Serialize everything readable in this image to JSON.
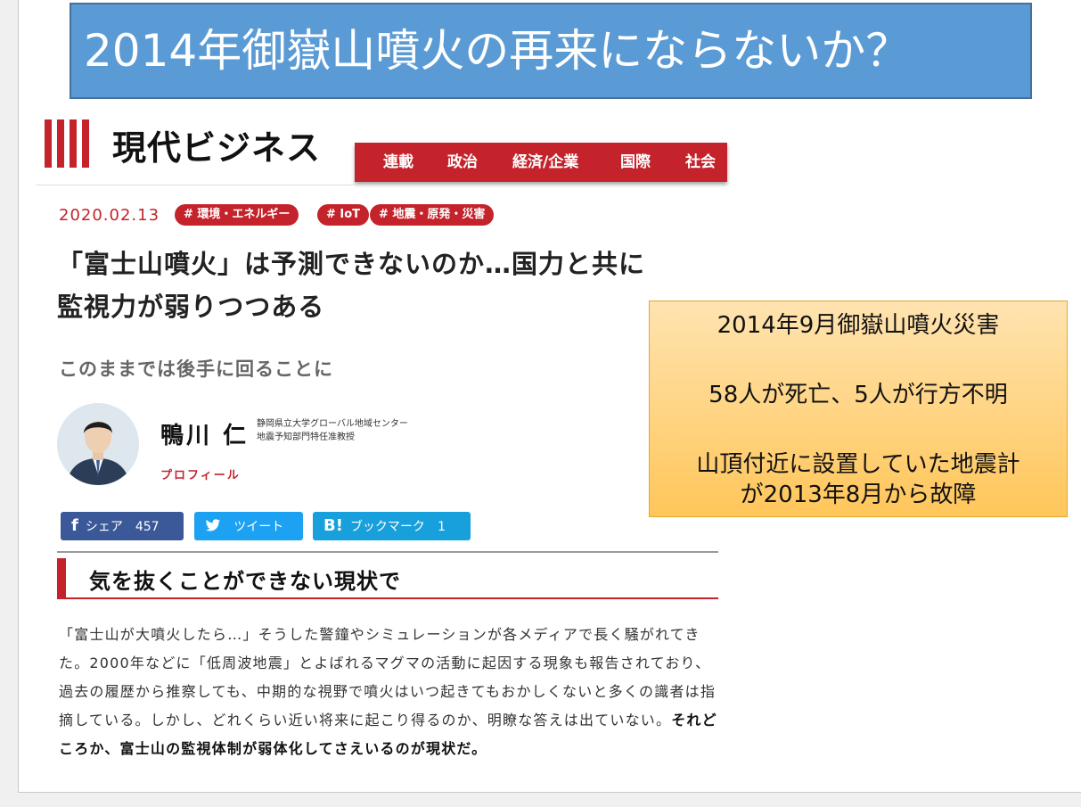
{
  "slide_title": "2014年御嶽山噴火の再来にならないか？",
  "site": {
    "logo_text": "現代ビジネス",
    "nav": [
      "連載",
      "政治",
      "経済/企業",
      "国際",
      "社会"
    ],
    "brand_color": "#c4232b"
  },
  "article": {
    "date": "2020.02.13",
    "tags": [
      "# 環境・エネルギー",
      "# IoT",
      "# 地震・原発・災害"
    ],
    "headline_line1": "「富士山噴火」は予測できないのか…国力と共に",
    "headline_line2": "監視力が弱りつつある",
    "subheadline": "このままでは後手に回ることに",
    "author": {
      "name": "鴨川 仁",
      "affiliation_line1": "静岡県立大学グローバル地域センター",
      "affiliation_line2": "地震予知部門特任准教授",
      "profile_label": "プロフィール"
    },
    "share": {
      "facebook_label": "シェア",
      "facebook_count": "457",
      "twitter_label": "ツイート",
      "hatena_label": "ブックマーク",
      "hatena_count": "1"
    },
    "section_heading": "気を抜くことができない現状で",
    "body_normal": "「富士山が大噴火したら…」そうした警鐘やシミュレーションが各メディアで長く騒がれてきた。2000年などに「低周波地震」とよばれるマグマの活動に起因する現象も報告されており、過去の履歴から推察しても、中期的な視野で噴火はいつ起きてもおかしくないと多くの識者は指摘している。しかし、どれくらい近い将来に起こり得るのか、明瞭な答えは出ていない。",
    "body_bold": "それどころか、富士山の監視体制が弱体化してさえいるのが現状だ。"
  },
  "callout": {
    "line1": "2014年9月御嶽山噴火災害",
    "line2": "58人が死亡、5人が行方不明",
    "line3": "山頂付近に設置していた地震計",
    "line4": "が2013年8月から故障"
  }
}
